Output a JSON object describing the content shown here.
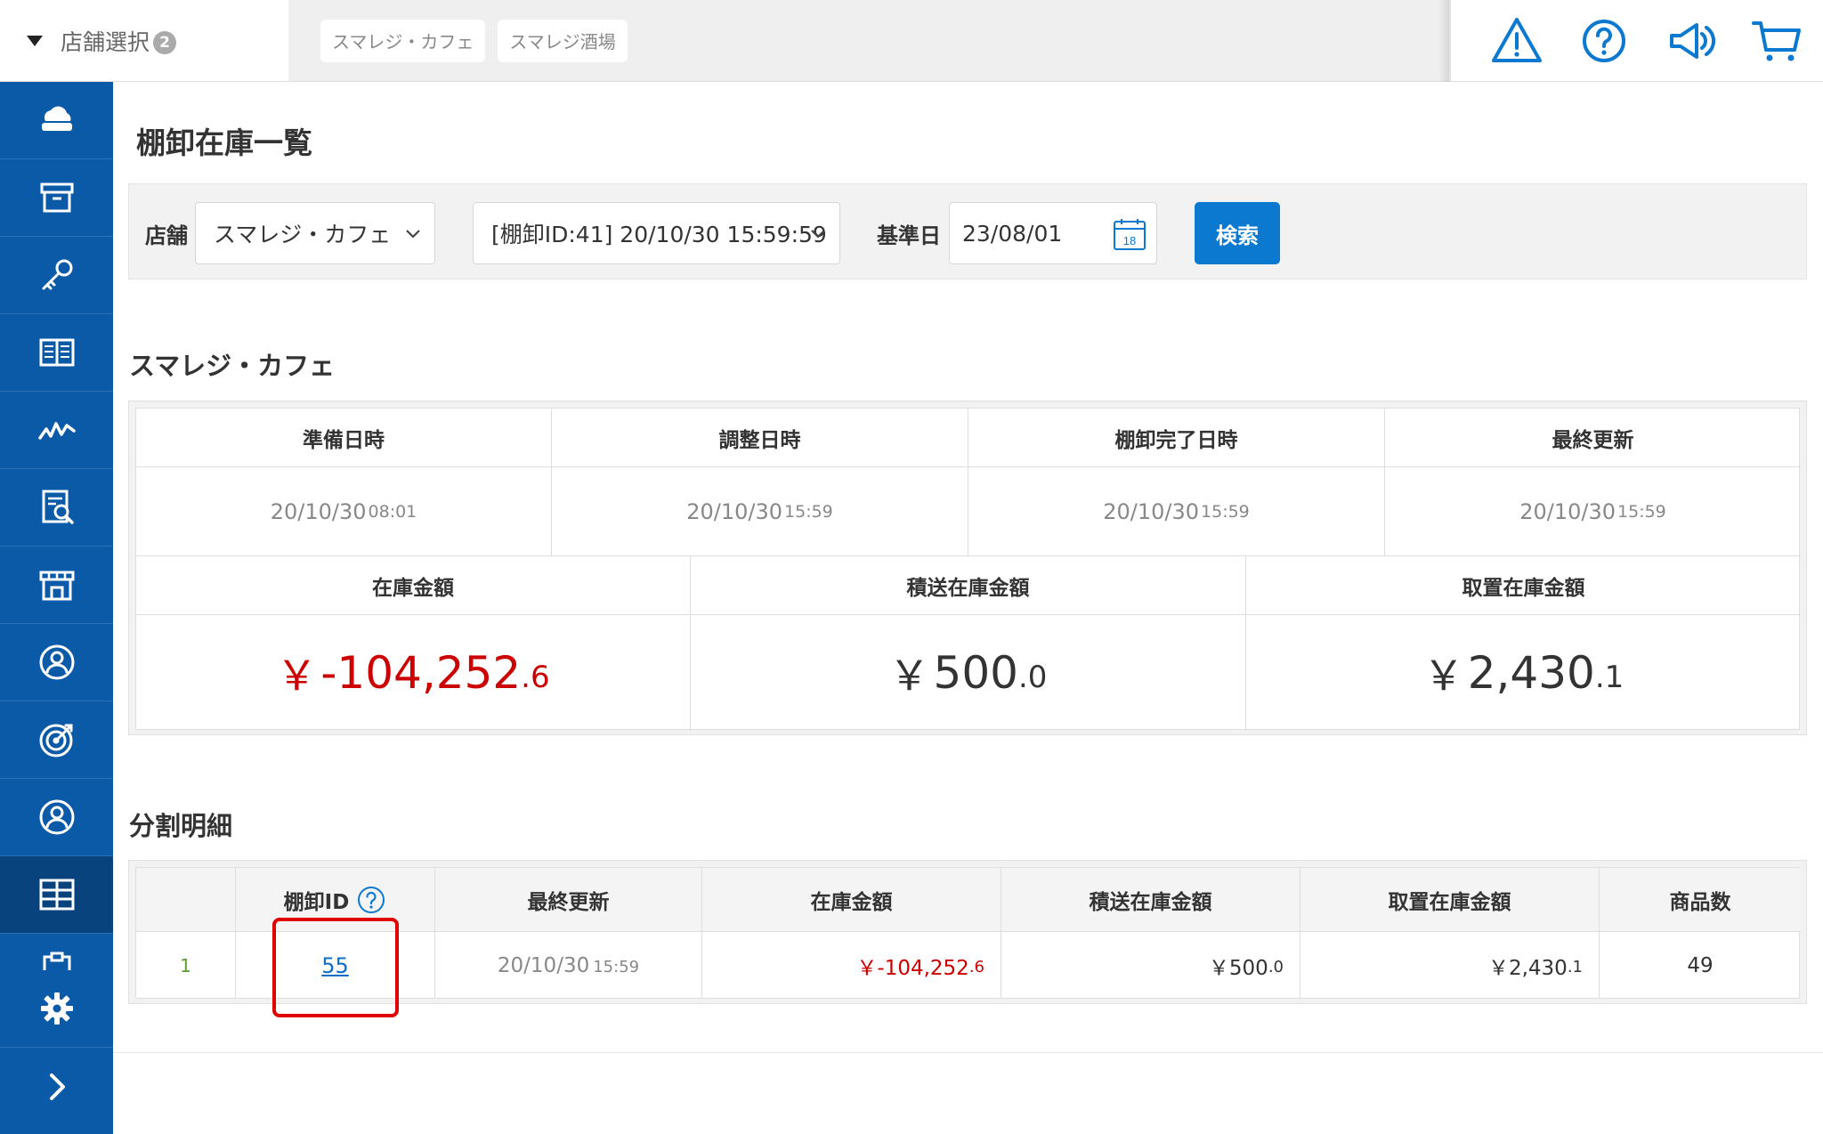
{
  "topbar": {
    "store_select_label": "店舗選択",
    "store_count": "2",
    "store_tabs": [
      "スマレジ・カフェ",
      "スマレジ酒場"
    ]
  },
  "page": {
    "title": "棚卸在庫一覧"
  },
  "filter": {
    "store_label": "店舗",
    "store_value": "スマレジ・カフェ",
    "inventory_value": "[棚卸ID:41] 20/10/30 15:59:59",
    "base_date_label": "基準日",
    "base_date_value": "23/08/01",
    "calendar_day": "18",
    "search_label": "検索"
  },
  "summary": {
    "store_name": "スマレジ・カフェ",
    "date_headers": [
      "準備日時",
      "調整日時",
      "棚卸完了日時",
      "最終更新"
    ],
    "dates": [
      {
        "date": "20/10/30",
        "time": "08:01"
      },
      {
        "date": "20/10/30",
        "time": "15:59"
      },
      {
        "date": "20/10/30",
        "time": "15:59"
      },
      {
        "date": "20/10/30",
        "time": "15:59"
      }
    ],
    "amount_headers": [
      "在庫金額",
      "積送在庫金額",
      "取置在庫金額"
    ],
    "amounts": [
      {
        "yen": "￥",
        "int": "-104,252",
        "dec": ".6"
      },
      {
        "yen": "￥",
        "int": "500",
        "dec": ".0"
      },
      {
        "yen": "￥",
        "int": "2,430",
        "dec": ".1"
      }
    ]
  },
  "breakdown": {
    "title": "分割明細",
    "headers": [
      "",
      "棚卸ID",
      "最終更新",
      "在庫金額",
      "積送在庫金額",
      "取置在庫金額",
      "商品数"
    ],
    "rows": [
      {
        "index": "1",
        "id": "55",
        "updated_date": "20/10/30",
        "updated_time": "15:59",
        "stock_int": "￥-104,252",
        "stock_dec": ".6",
        "transit_int": "￥500",
        "transit_dec": ".0",
        "reserved_int": "￥2,430",
        "reserved_dec": ".1",
        "items": "49"
      }
    ]
  },
  "colors": {
    "sidebar": "#0b5aa8",
    "sidebar_active": "#08437d",
    "accent": "#0b79d0",
    "negative": "#cc0000",
    "highlight": "#e00000"
  }
}
